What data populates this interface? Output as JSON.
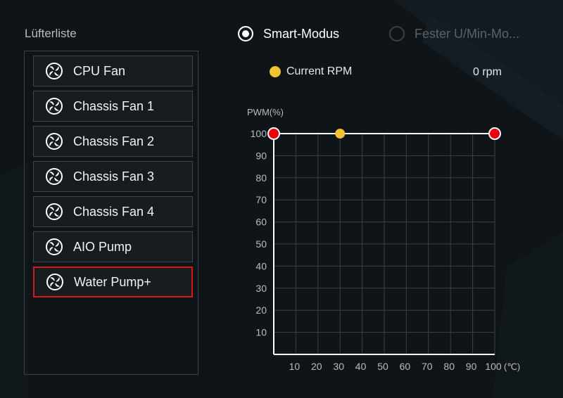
{
  "sidebar": {
    "title": "Lüfterliste",
    "items": [
      {
        "label": "CPU Fan",
        "selected": false
      },
      {
        "label": "Chassis Fan 1",
        "selected": false
      },
      {
        "label": "Chassis Fan 2",
        "selected": false
      },
      {
        "label": "Chassis Fan 3",
        "selected": false
      },
      {
        "label": "Chassis Fan 4",
        "selected": false
      },
      {
        "label": "AIO Pump",
        "selected": false
      },
      {
        "label": "Water Pump+",
        "selected": true
      }
    ]
  },
  "mode": {
    "smart_label": "Smart-Modus",
    "fixed_label": "Fester U/Min-Mo...",
    "selected": "smart"
  },
  "rpm": {
    "label": "Current RPM",
    "value": "0 rpm",
    "indicator_color": "#f2c230"
  },
  "colors": {
    "accent_red": "#d8161c",
    "point_red": "#e8000e",
    "current_yellow": "#f2c230"
  },
  "chart_data": {
    "type": "line",
    "ylabel": "PWM(%)",
    "xlabel": "(℃)",
    "xlim": [
      0,
      100
    ],
    "ylim": [
      0,
      100
    ],
    "x_ticks": [
      "10",
      "20",
      "30",
      "40",
      "50",
      "60",
      "70",
      "80",
      "90",
      "100"
    ],
    "y_ticks": [
      "100",
      "90",
      "80",
      "70",
      "60",
      "50",
      "40",
      "30",
      "20",
      "10"
    ],
    "grid": true,
    "series": [
      {
        "points": [
          {
            "x": 0,
            "y": 100
          },
          {
            "x": 100,
            "y": 100
          }
        ],
        "color": "#ffffff"
      }
    ],
    "control_points": [
      {
        "x": 0,
        "y": 100
      },
      {
        "x": 100,
        "y": 100
      }
    ],
    "current_point": {
      "x": 30,
      "y": 100
    }
  }
}
